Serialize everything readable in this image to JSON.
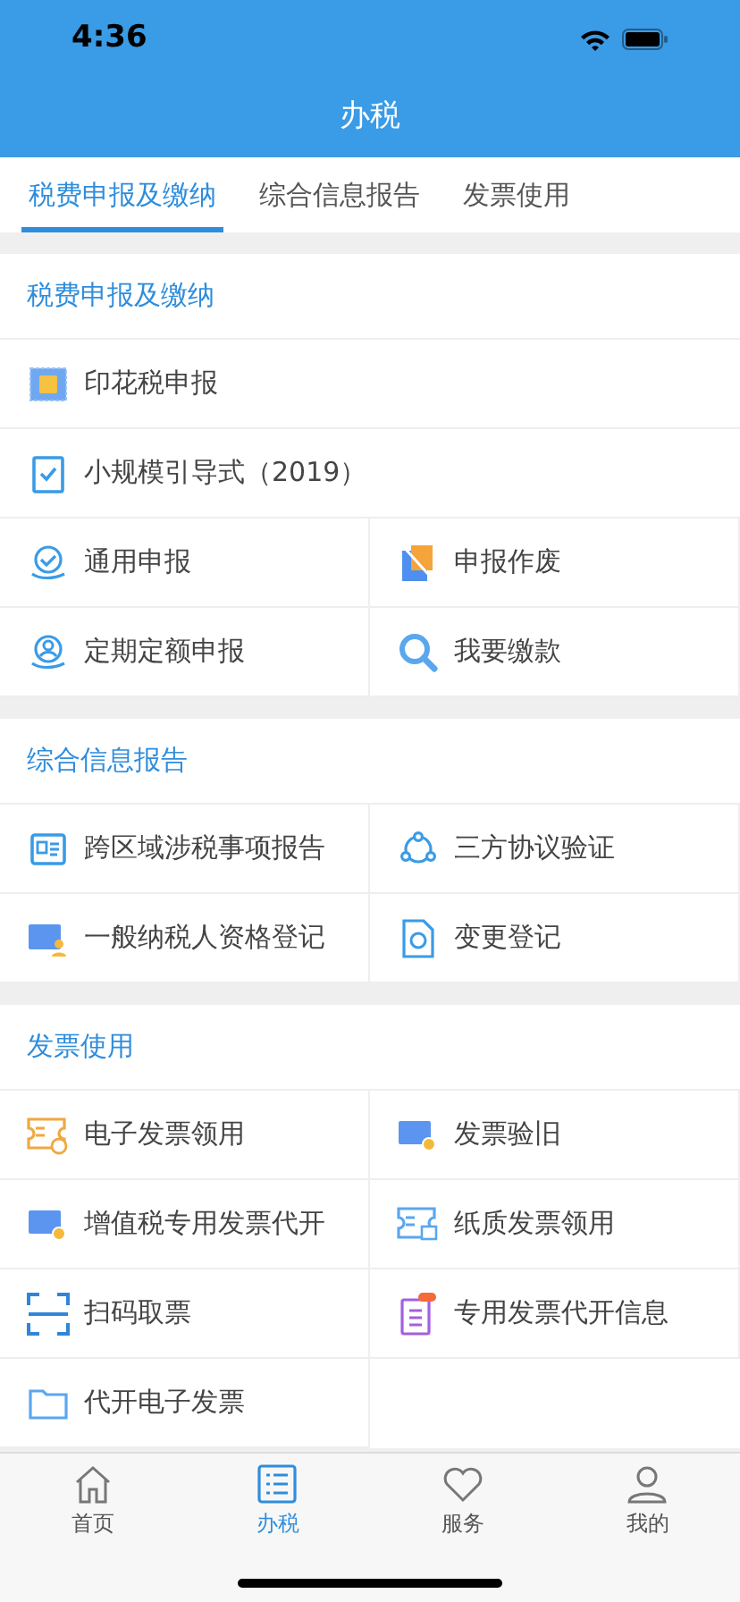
{
  "status_bar": {
    "time": "4:36"
  },
  "header": {
    "title": "办税"
  },
  "tabs": [
    {
      "label": "税费申报及缴纳",
      "selected": true
    },
    {
      "label": "综合信息报告",
      "selected": false
    },
    {
      "label": "发票使用",
      "selected": false
    }
  ],
  "sections": [
    {
      "title": "税费申报及缴纳",
      "items": [
        {
          "label": "印花税申报",
          "kind": "wide"
        },
        {
          "label": "小规模引导式（2019）",
          "kind": "wide"
        },
        {
          "label": "通用申报",
          "kind": "half"
        },
        {
          "label": "申报作废",
          "kind": "half"
        },
        {
          "label": "定期定额申报",
          "kind": "half"
        },
        {
          "label": "我要缴款",
          "kind": "half"
        }
      ]
    },
    {
      "title": "综合信息报告",
      "items": [
        {
          "label": "跨区域涉税事项报告",
          "kind": "half"
        },
        {
          "label": "三方协议验证",
          "kind": "half"
        },
        {
          "label": "一般纳税人资格登记",
          "kind": "half"
        },
        {
          "label": "变更登记",
          "kind": "half"
        }
      ]
    },
    {
      "title": "发票使用",
      "items": [
        {
          "label": "电子发票领用",
          "kind": "half"
        },
        {
          "label": "发票验旧",
          "kind": "half"
        },
        {
          "label": "增值税专用发票代开",
          "kind": "half"
        },
        {
          "label": "纸质发票领用",
          "kind": "half"
        },
        {
          "label": "扫码取票",
          "kind": "half"
        },
        {
          "label": "专用发票代开信息",
          "kind": "half"
        },
        {
          "label": "代开电子发票",
          "kind": "half"
        }
      ]
    }
  ],
  "tab_bar": [
    {
      "label": "首页",
      "selected": false
    },
    {
      "label": "办税",
      "selected": true
    },
    {
      "label": "服务",
      "selected": false
    },
    {
      "label": "我的",
      "selected": false
    }
  ]
}
